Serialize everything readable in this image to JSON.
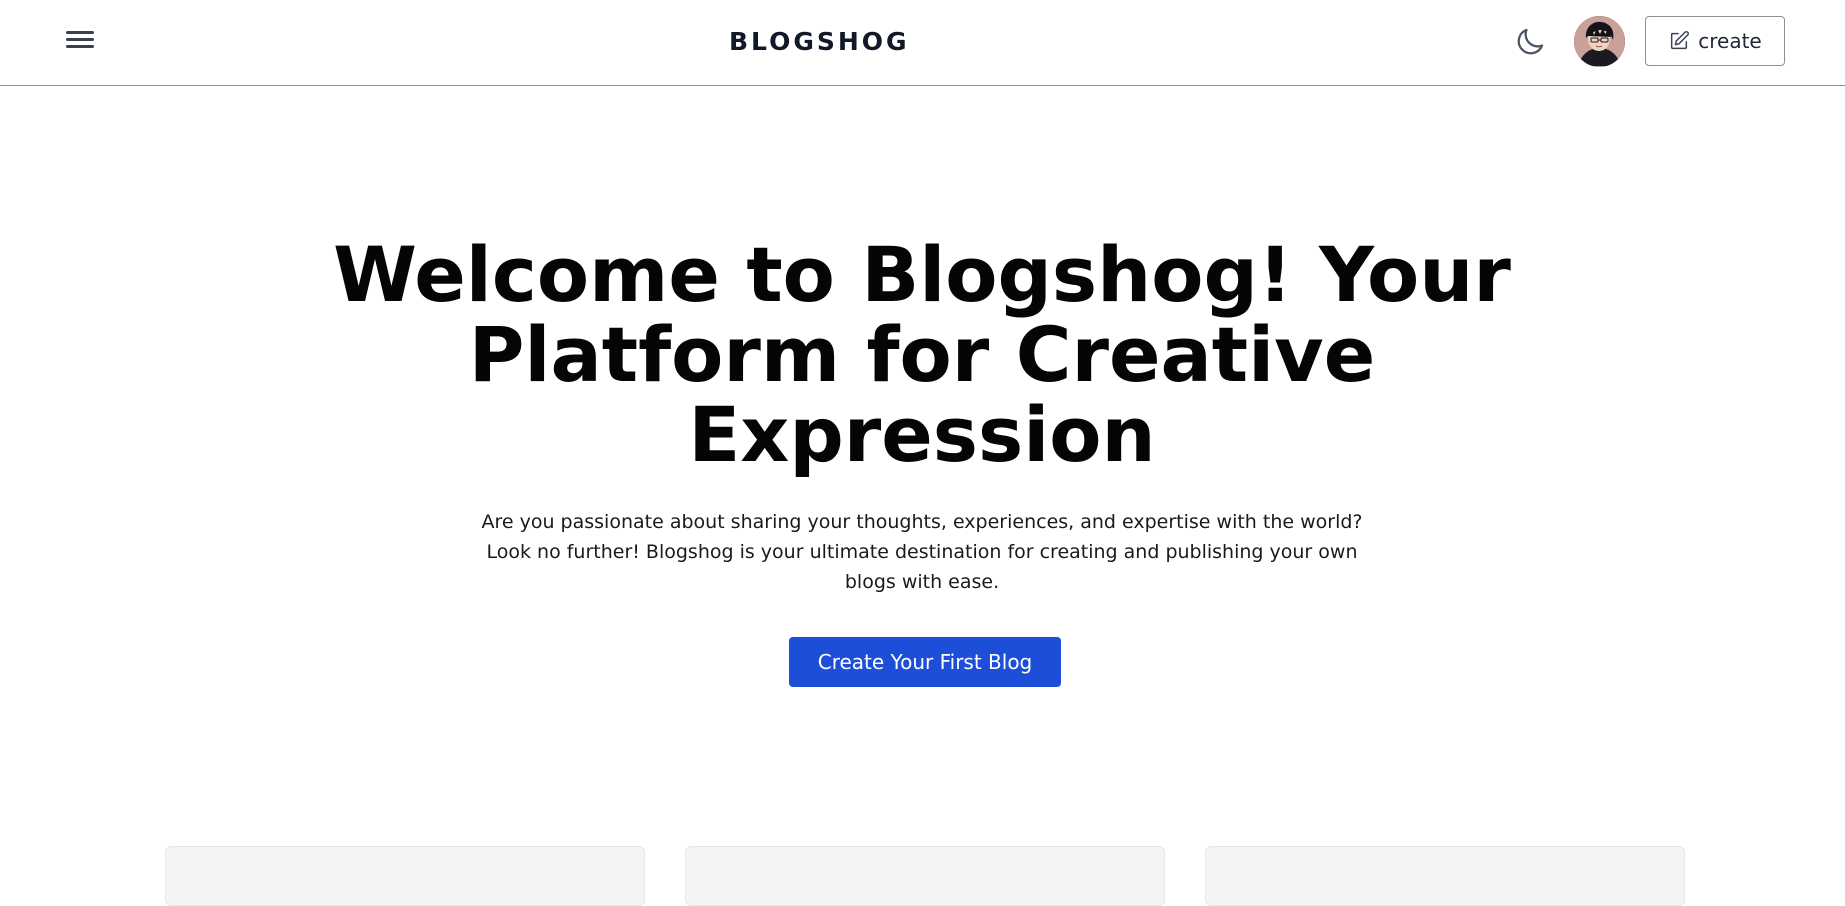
{
  "header": {
    "brand": "BLOGSHOG",
    "menu_icon": "hamburger-menu-icon",
    "theme_icon": "moon-icon",
    "avatar_icon": "user-avatar",
    "create_label": "create",
    "create_icon": "edit-square-icon"
  },
  "hero": {
    "title": "Welcome to Blogshog! Your Platform for Creative Expression",
    "subtitle": "Are you passionate about sharing your thoughts, experiences, and expertise with the world? Look no further! Blogshog is your ultimate destination for creating and publishing your own blogs with ease.",
    "cta_label": "Create Your First Blog"
  },
  "colors": {
    "accent": "#1d4ed8",
    "header_border": "#8a8f98",
    "card_bg": "#f3f4f6",
    "text_dark": "#050505"
  }
}
